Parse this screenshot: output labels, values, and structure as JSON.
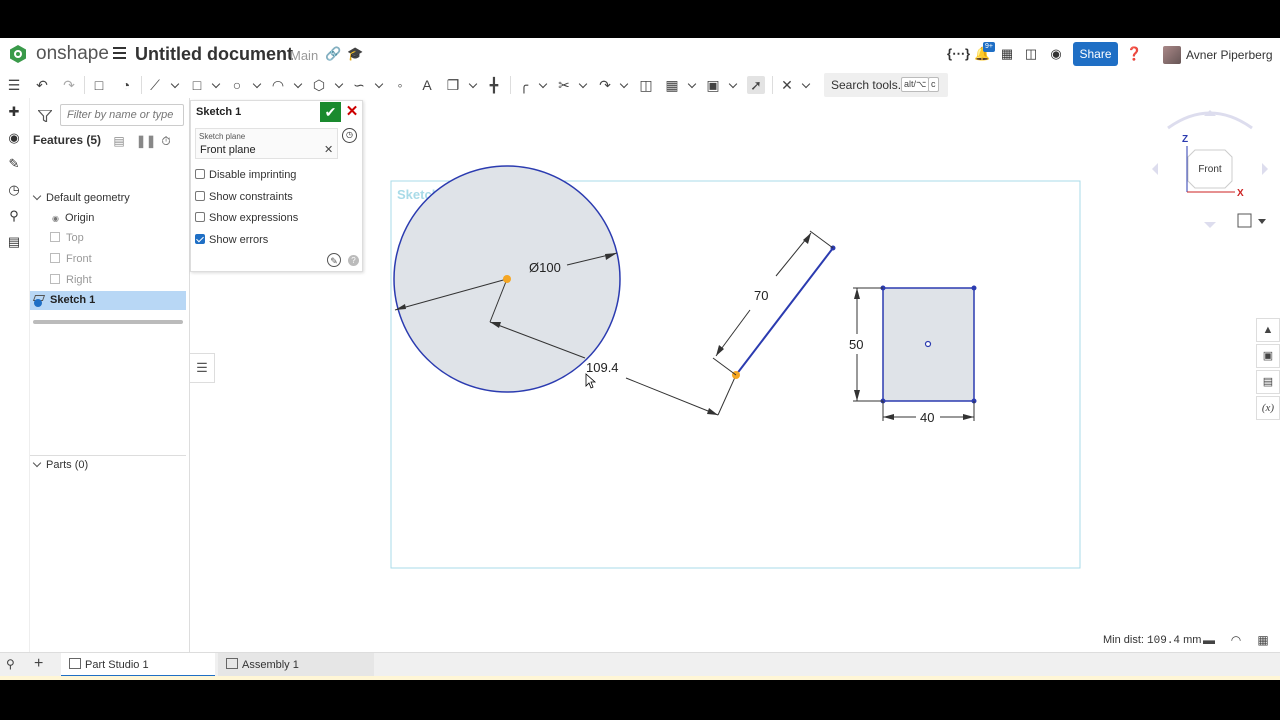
{
  "header": {
    "brand": "onshape",
    "document_title": "Untitled document",
    "branch": "Main",
    "share_label": "Share",
    "user_name": "Avner Piperberg",
    "notification_badge": "9+"
  },
  "toolbar": {
    "search_label": "Search tools...",
    "kbd_1": "alt/⌥",
    "kbd_2": "c"
  },
  "feature_panel": {
    "filter_placeholder": "Filter by name or type",
    "features_label": "Features (5)",
    "default_geometry": "Default geometry",
    "items": [
      {
        "label": "Origin"
      },
      {
        "label": "Top"
      },
      {
        "label": "Front"
      },
      {
        "label": "Right"
      }
    ],
    "sketch_item": "Sketch 1",
    "parts_label": "Parts (0)"
  },
  "sketch_dialog": {
    "title": "Sketch 1",
    "plane_caption": "Sketch plane",
    "plane_value": "Front plane",
    "options": [
      {
        "label": "Disable imprinting",
        "checked": false
      },
      {
        "label": "Show constraints",
        "checked": false
      },
      {
        "label": "Show expressions",
        "checked": false
      },
      {
        "label": "Show errors",
        "checked": true
      }
    ]
  },
  "canvas": {
    "sketch_label": "Sketch 1",
    "dim_diameter": "Ø100",
    "dim_distance": "109.4",
    "dim_line_length": "70",
    "dim_rect_height": "50",
    "dim_rect_width": "40",
    "view_cube_label": "Front",
    "axis_z": "Z",
    "axis_x": "X"
  },
  "status": {
    "label": "Min dist:",
    "value": "109.4",
    "unit": "mm"
  },
  "tabs": [
    {
      "label": "Part Studio 1",
      "active": true
    },
    {
      "label": "Assembly 1",
      "active": false
    }
  ],
  "colors": {
    "accent": "#1f6fc5",
    "sketch_blue": "#2b3bb0",
    "sketch_fill": "#dfe3e8",
    "point_orange": "#f5a623",
    "selected_row": "#b8d7f5"
  }
}
